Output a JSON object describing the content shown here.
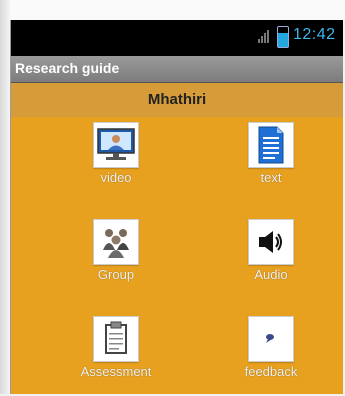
{
  "status_bar": {
    "time": "12:42",
    "icons": [
      "signal-icon",
      "battery-icon"
    ]
  },
  "app": {
    "title": "Research guide",
    "subtitle": "Mhathiri"
  },
  "menu": [
    {
      "label": "video",
      "icon": "video-icon"
    },
    {
      "label": "text",
      "icon": "document-icon"
    },
    {
      "label": "Group",
      "icon": "group-icon"
    },
    {
      "label": "Audio",
      "icon": "speaker-icon"
    },
    {
      "label": "Assessment",
      "icon": "clipboard-icon"
    },
    {
      "label": "feedback",
      "icon": "speech-bubble-icon"
    }
  ],
  "colors": {
    "background": "#e8a11f",
    "header": "#d79c3a",
    "titlebar": "#8a8a8a",
    "clock": "#3fb7e8"
  }
}
